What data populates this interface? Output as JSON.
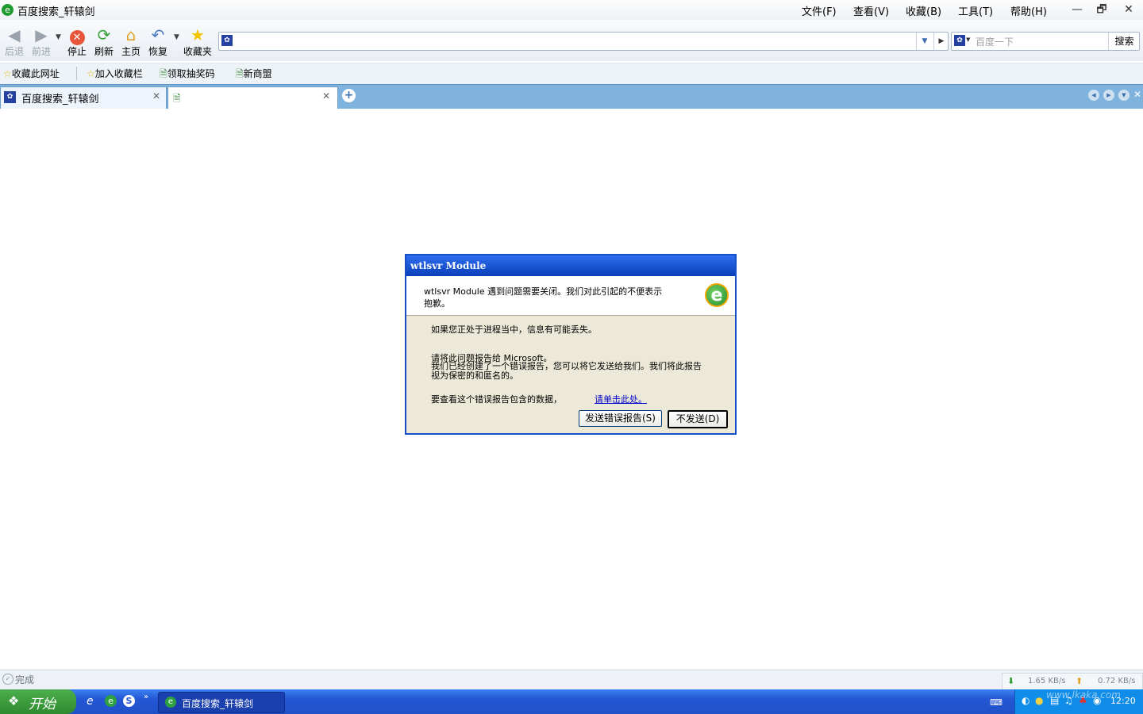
{
  "window": {
    "title": "百度搜索_轩辕剑",
    "menu": [
      "文件(F)",
      "查看(V)",
      "收藏(B)",
      "工具(T)",
      "帮助(H)"
    ],
    "controls": {
      "minimize": "—",
      "maximize": "🗗",
      "close": "✕"
    }
  },
  "toolbar": {
    "back": "后退",
    "forward": "前进",
    "stop": "停止",
    "refresh": "刷新",
    "home": "主页",
    "restore": "恢复",
    "favorites": "收藏夹",
    "address_value": "",
    "search_placeholder": "百度一下",
    "search_button": "搜索"
  },
  "favbar": {
    "items": [
      "收藏此网址",
      "加入收藏栏",
      "领取抽奖码",
      "新商盟"
    ]
  },
  "tabs": [
    {
      "label": "百度搜索_轩辕剑"
    },
    {
      "label": ""
    }
  ],
  "dialog": {
    "title": "wtlsvr Module",
    "header_text": "wtlsvr Module 遇到问题需要关闭。我们对此引起的不便表示抱歉。",
    "line1": "如果您正处于进程当中，信息有可能丢失。",
    "line2": "请将此问题报告给 Microsoft。",
    "line3": "我们已经创建了一个错误报告，您可以将它发送给我们。我们将此报告视为保密的和匿名的。",
    "line4": "要查看这个错误报告包含的数据，",
    "link": "请单击此处。",
    "send_button": "发送错误报告(S)",
    "dont_send_button": "不发送(D)"
  },
  "statusbar": {
    "status": "完成",
    "download_speed": "1.65 KB/s",
    "upload_speed": "0.72 KB/s"
  },
  "taskbar": {
    "start": "开始",
    "task": "百度搜索_轩辕剑",
    "clock": "12:20",
    "watermark": "www.lkaka.com"
  }
}
